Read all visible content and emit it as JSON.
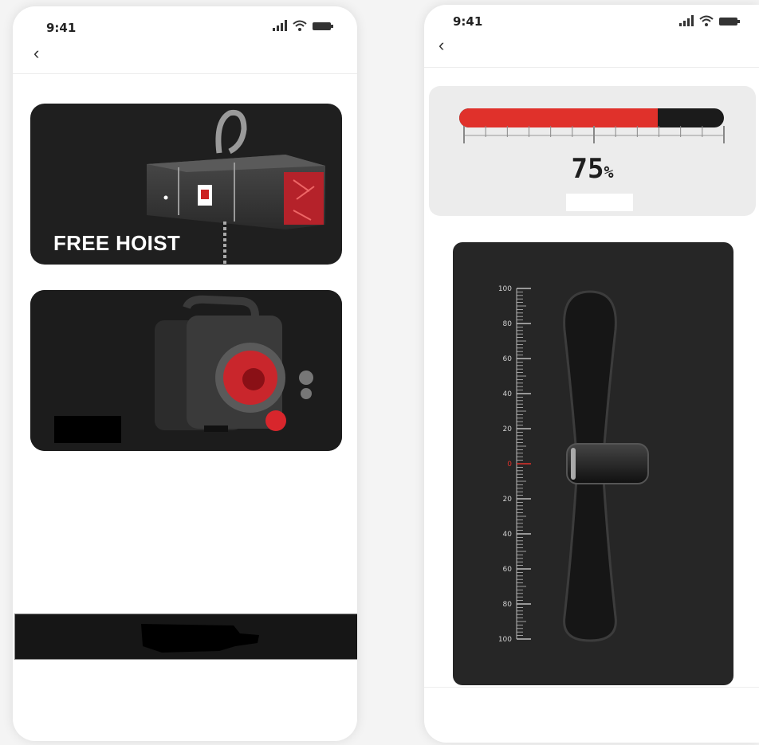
{
  "left_screen": {
    "status": {
      "time": "9:41"
    },
    "nav": {
      "back_glyph": "‹"
    },
    "cards": [
      {
        "label": "FREE HOIST",
        "image": "hoist-image"
      },
      {
        "label": "",
        "image": "winch-image"
      }
    ]
  },
  "right_screen": {
    "status": {
      "time": "9:41"
    },
    "nav": {
      "back_glyph": "‹"
    },
    "gauge": {
      "value": 75,
      "display": "75",
      "unit": "%"
    },
    "slider": {
      "value": 0,
      "scale_labels": [
        "100",
        "80",
        "60",
        "40",
        "20",
        "0",
        "20",
        "40",
        "60",
        "80",
        "100"
      ]
    }
  },
  "colors": {
    "accent": "#e0312b",
    "panel_dark": "#262626",
    "card_dark": "#1f1f1f"
  },
  "icons": [
    "signal-icon",
    "wifi-icon",
    "battery-icon",
    "back-icon"
  ]
}
